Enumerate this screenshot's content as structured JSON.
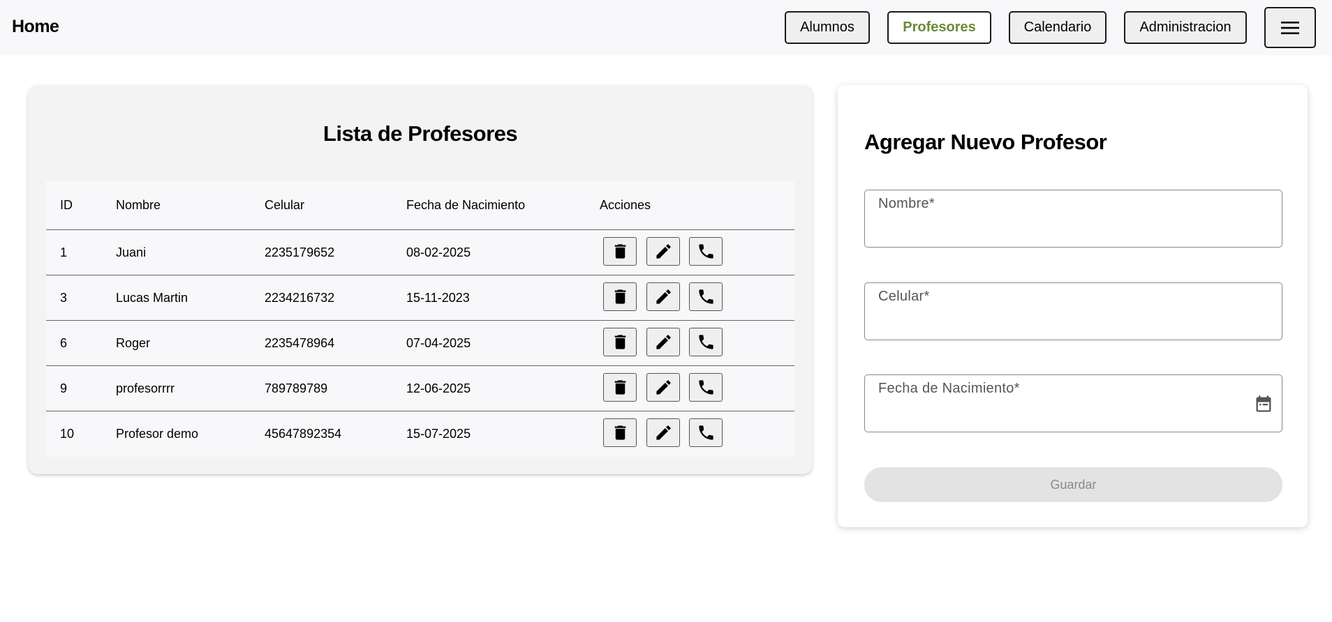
{
  "header": {
    "brand": "Home",
    "nav": [
      {
        "label": "Alumnos",
        "active": false
      },
      {
        "label": "Profesores",
        "active": true
      },
      {
        "label": "Calendario",
        "active": false
      },
      {
        "label": "Administracion",
        "active": false
      }
    ],
    "menu_icon": "hamburger-icon"
  },
  "list": {
    "title": "Lista de Profesores",
    "columns": [
      "ID",
      "Nombre",
      "Celular",
      "Fecha de Nacimiento",
      "Acciones"
    ],
    "rows": [
      {
        "id": "1",
        "nombre": "Juani",
        "celular": "2235179652",
        "fecha": "08-02-2025"
      },
      {
        "id": "3",
        "nombre": "Lucas Martin",
        "celular": "2234216732",
        "fecha": "15-11-2023"
      },
      {
        "id": "6",
        "nombre": "Roger",
        "celular": "2235478964",
        "fecha": "07-04-2025"
      },
      {
        "id": "9",
        "nombre": "profesorrrr",
        "celular": "789789789",
        "fecha": "12-06-2025"
      },
      {
        "id": "10",
        "nombre": "Profesor demo",
        "celular": "45647892354",
        "fecha": "15-07-2025"
      }
    ],
    "action_icons": [
      "trash-icon",
      "pencil-icon",
      "phone-icon"
    ]
  },
  "form": {
    "title": "Agregar Nuevo Profesor",
    "fields": [
      {
        "label": "Nombre*",
        "value": ""
      },
      {
        "label": "Celular*",
        "value": ""
      },
      {
        "label": "Fecha de Nacimiento*",
        "value": "",
        "icon": "calendar-icon"
      }
    ],
    "submit_label": "Guardar"
  },
  "colors": {
    "active_nav": "#6a8a3a",
    "page_bg": "#ffffff",
    "card_bg": "#f3f3f4"
  }
}
